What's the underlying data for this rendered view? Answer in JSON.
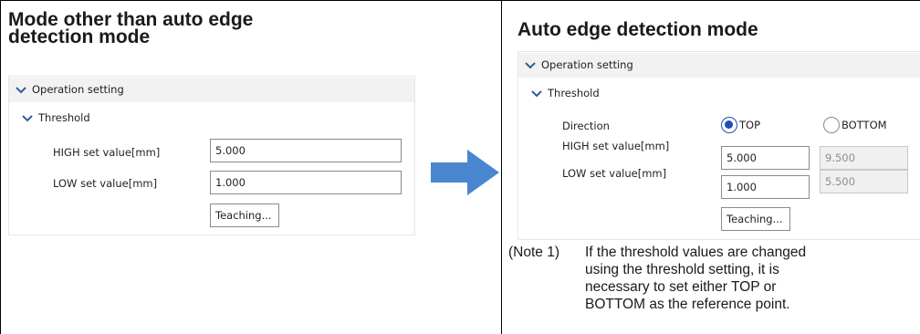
{
  "left": {
    "heading": [
      "Mode other than auto edge",
      "detection mode"
    ],
    "panel": {
      "section_label": "Operation setting",
      "subsection_label": "Threshold",
      "high_label": "HIGH set value[mm]",
      "high_value": "5.000",
      "low_label": "LOW set value[mm]",
      "low_value": "1.000",
      "teaching_label": "Teaching..."
    }
  },
  "right": {
    "heading": "Auto edge detection mode",
    "panel": {
      "section_label": "Operation setting",
      "subsection_label": "Threshold",
      "direction_label": "Direction",
      "option_top": "TOP",
      "option_bottom": "BOTTOM",
      "selected_direction": "TOP",
      "high_label": "HIGH set value[mm]",
      "high_value": "5.000",
      "high_value_disabled": "9.500",
      "low_label": "LOW set value[mm]",
      "low_value": "1.000",
      "low_value_disabled": "5.500",
      "teaching_label": "Teaching..."
    },
    "note": {
      "marker": "(Note 1)",
      "lines": [
        "If the threshold values are changed",
        "using the threshold setting, it is",
        "necessary to set either TOP or",
        "BOTTOM as the reference point."
      ]
    }
  },
  "arrow_icon": "right-arrow-icon",
  "colors": {
    "arrow": "#4a86cf",
    "chevron": "#2f5d9e",
    "radio_selected": "#1f4fb5",
    "band": "#f2f2f2"
  }
}
